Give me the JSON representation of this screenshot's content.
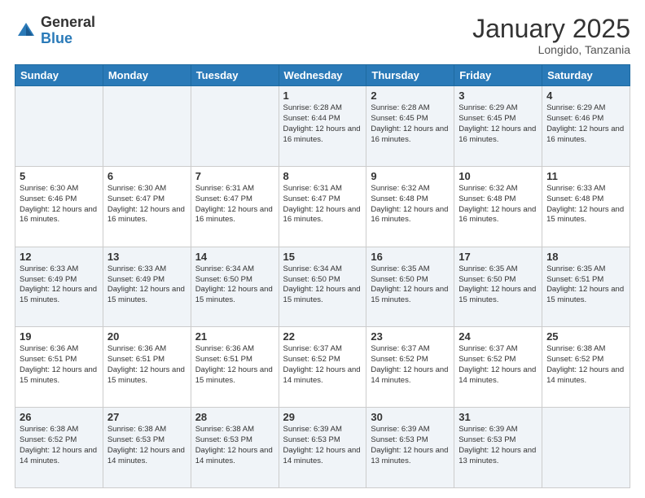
{
  "header": {
    "logo_general": "General",
    "logo_blue": "Blue",
    "month_title": "January 2025",
    "location": "Longido, Tanzania"
  },
  "days_of_week": [
    "Sunday",
    "Monday",
    "Tuesday",
    "Wednesday",
    "Thursday",
    "Friday",
    "Saturday"
  ],
  "weeks": [
    [
      {
        "day": "",
        "info": ""
      },
      {
        "day": "",
        "info": ""
      },
      {
        "day": "",
        "info": ""
      },
      {
        "day": "1",
        "info": "Sunrise: 6:28 AM\nSunset: 6:44 PM\nDaylight: 12 hours and 16 minutes."
      },
      {
        "day": "2",
        "info": "Sunrise: 6:28 AM\nSunset: 6:45 PM\nDaylight: 12 hours and 16 minutes."
      },
      {
        "day": "3",
        "info": "Sunrise: 6:29 AM\nSunset: 6:45 PM\nDaylight: 12 hours and 16 minutes."
      },
      {
        "day": "4",
        "info": "Sunrise: 6:29 AM\nSunset: 6:46 PM\nDaylight: 12 hours and 16 minutes."
      }
    ],
    [
      {
        "day": "5",
        "info": "Sunrise: 6:30 AM\nSunset: 6:46 PM\nDaylight: 12 hours and 16 minutes."
      },
      {
        "day": "6",
        "info": "Sunrise: 6:30 AM\nSunset: 6:47 PM\nDaylight: 12 hours and 16 minutes."
      },
      {
        "day": "7",
        "info": "Sunrise: 6:31 AM\nSunset: 6:47 PM\nDaylight: 12 hours and 16 minutes."
      },
      {
        "day": "8",
        "info": "Sunrise: 6:31 AM\nSunset: 6:47 PM\nDaylight: 12 hours and 16 minutes."
      },
      {
        "day": "9",
        "info": "Sunrise: 6:32 AM\nSunset: 6:48 PM\nDaylight: 12 hours and 16 minutes."
      },
      {
        "day": "10",
        "info": "Sunrise: 6:32 AM\nSunset: 6:48 PM\nDaylight: 12 hours and 16 minutes."
      },
      {
        "day": "11",
        "info": "Sunrise: 6:33 AM\nSunset: 6:48 PM\nDaylight: 12 hours and 15 minutes."
      }
    ],
    [
      {
        "day": "12",
        "info": "Sunrise: 6:33 AM\nSunset: 6:49 PM\nDaylight: 12 hours and 15 minutes."
      },
      {
        "day": "13",
        "info": "Sunrise: 6:33 AM\nSunset: 6:49 PM\nDaylight: 12 hours and 15 minutes."
      },
      {
        "day": "14",
        "info": "Sunrise: 6:34 AM\nSunset: 6:50 PM\nDaylight: 12 hours and 15 minutes."
      },
      {
        "day": "15",
        "info": "Sunrise: 6:34 AM\nSunset: 6:50 PM\nDaylight: 12 hours and 15 minutes."
      },
      {
        "day": "16",
        "info": "Sunrise: 6:35 AM\nSunset: 6:50 PM\nDaylight: 12 hours and 15 minutes."
      },
      {
        "day": "17",
        "info": "Sunrise: 6:35 AM\nSunset: 6:50 PM\nDaylight: 12 hours and 15 minutes."
      },
      {
        "day": "18",
        "info": "Sunrise: 6:35 AM\nSunset: 6:51 PM\nDaylight: 12 hours and 15 minutes."
      }
    ],
    [
      {
        "day": "19",
        "info": "Sunrise: 6:36 AM\nSunset: 6:51 PM\nDaylight: 12 hours and 15 minutes."
      },
      {
        "day": "20",
        "info": "Sunrise: 6:36 AM\nSunset: 6:51 PM\nDaylight: 12 hours and 15 minutes."
      },
      {
        "day": "21",
        "info": "Sunrise: 6:36 AM\nSunset: 6:51 PM\nDaylight: 12 hours and 15 minutes."
      },
      {
        "day": "22",
        "info": "Sunrise: 6:37 AM\nSunset: 6:52 PM\nDaylight: 12 hours and 14 minutes."
      },
      {
        "day": "23",
        "info": "Sunrise: 6:37 AM\nSunset: 6:52 PM\nDaylight: 12 hours and 14 minutes."
      },
      {
        "day": "24",
        "info": "Sunrise: 6:37 AM\nSunset: 6:52 PM\nDaylight: 12 hours and 14 minutes."
      },
      {
        "day": "25",
        "info": "Sunrise: 6:38 AM\nSunset: 6:52 PM\nDaylight: 12 hours and 14 minutes."
      }
    ],
    [
      {
        "day": "26",
        "info": "Sunrise: 6:38 AM\nSunset: 6:52 PM\nDaylight: 12 hours and 14 minutes."
      },
      {
        "day": "27",
        "info": "Sunrise: 6:38 AM\nSunset: 6:53 PM\nDaylight: 12 hours and 14 minutes."
      },
      {
        "day": "28",
        "info": "Sunrise: 6:38 AM\nSunset: 6:53 PM\nDaylight: 12 hours and 14 minutes."
      },
      {
        "day": "29",
        "info": "Sunrise: 6:39 AM\nSunset: 6:53 PM\nDaylight: 12 hours and 14 minutes."
      },
      {
        "day": "30",
        "info": "Sunrise: 6:39 AM\nSunset: 6:53 PM\nDaylight: 12 hours and 13 minutes."
      },
      {
        "day": "31",
        "info": "Sunrise: 6:39 AM\nSunset: 6:53 PM\nDaylight: 12 hours and 13 minutes."
      },
      {
        "day": "",
        "info": ""
      }
    ]
  ]
}
